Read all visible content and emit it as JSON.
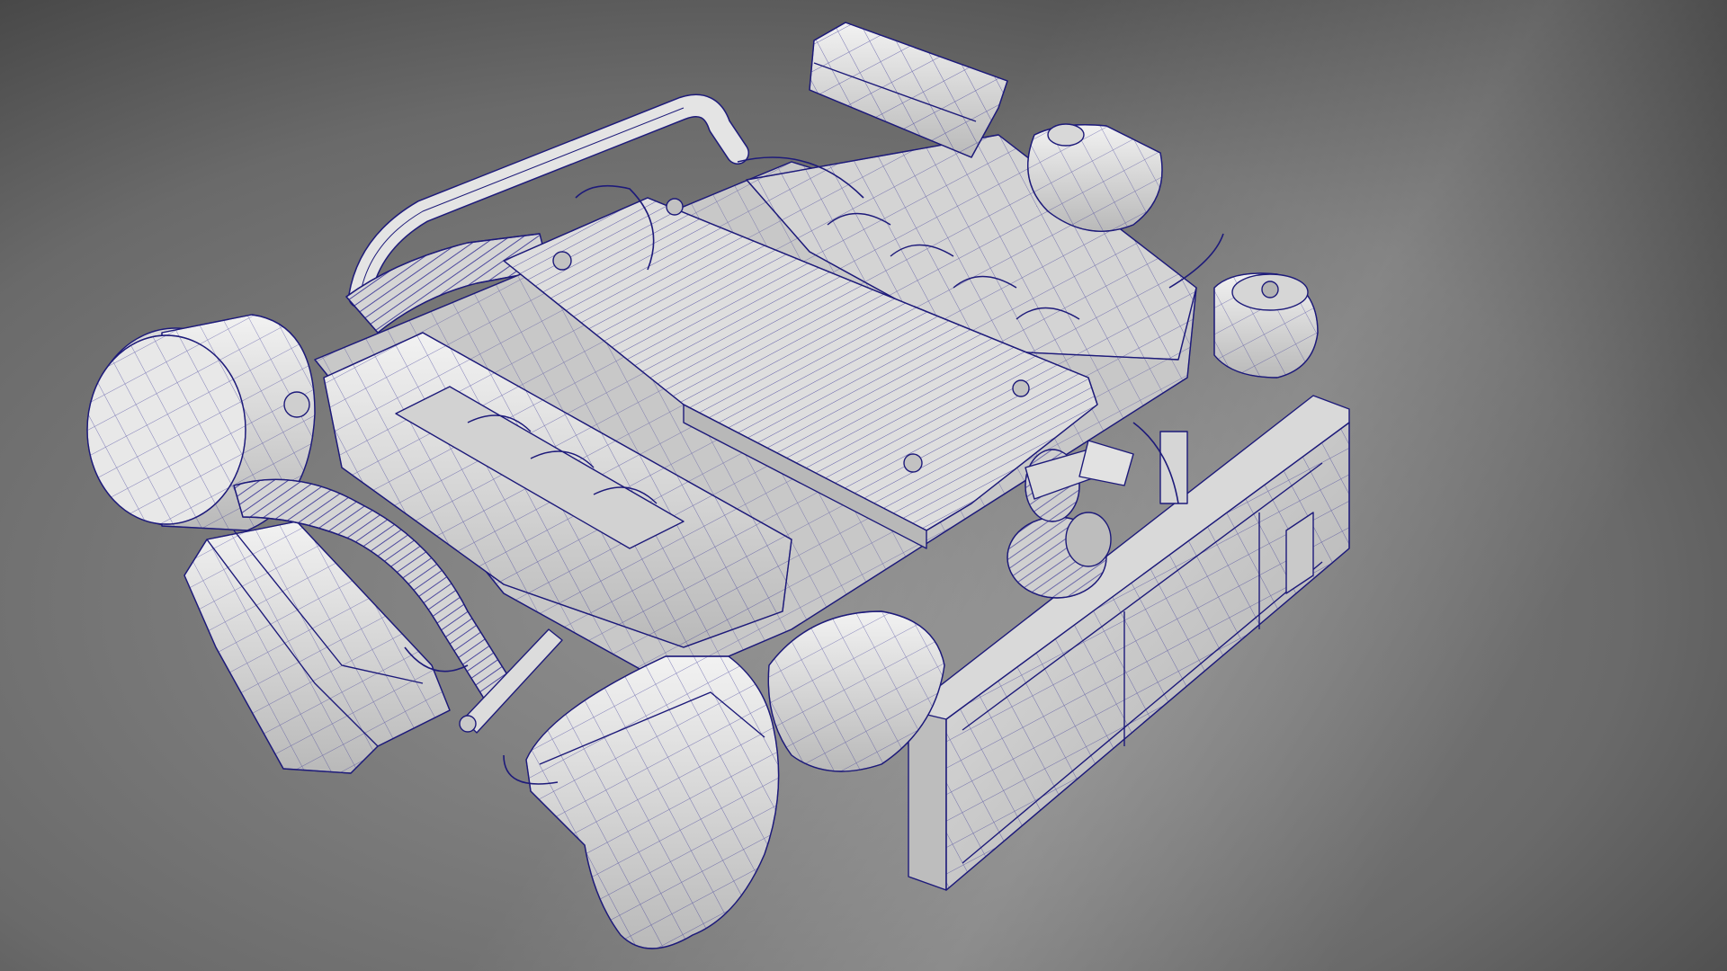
{
  "viewport": {
    "content": "engine-wireframe-model",
    "display_mode": "wireframe-on-shaded",
    "background": {
      "center": "#8a8a8a",
      "edge_dark": "#262626",
      "highlight": "#b8b8b8"
    },
    "colors": {
      "surface_light": "#eeeeee",
      "surface_mid": "#cfcfcf",
      "surface_dark": "#9c9c9c",
      "wire": "#1d1a7a"
    }
  }
}
